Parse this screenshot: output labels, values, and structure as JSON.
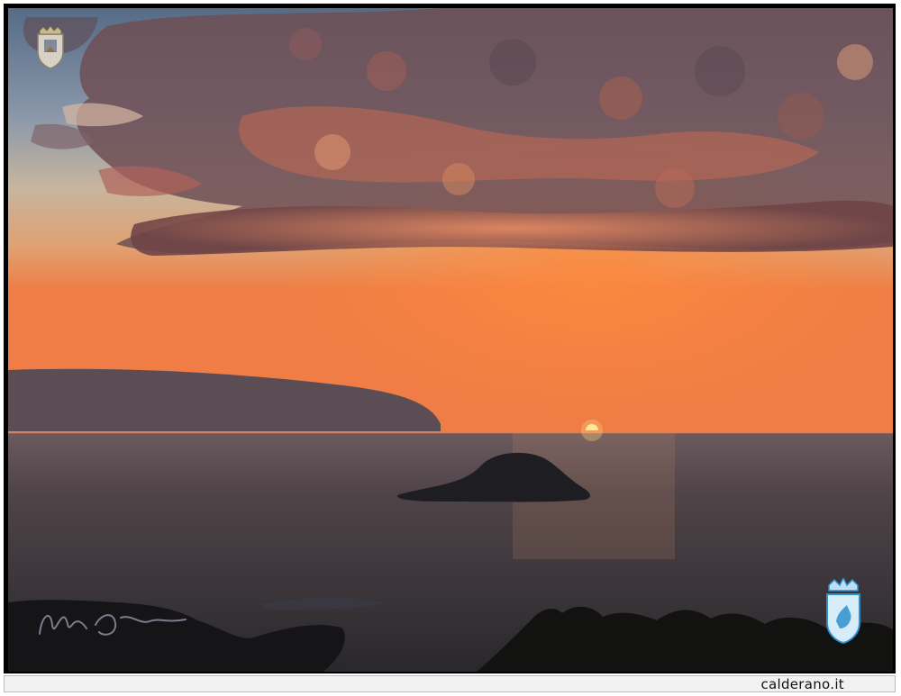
{
  "caption": {
    "site": "calderano.it"
  },
  "scene": {
    "sky_top": "#5b6f8a",
    "sky_mid": "#c9a98a",
    "horizon_glow": "#f07a3a",
    "sea": "#3a3438",
    "sun": "#fff3b0",
    "cloud": "#7a4a48",
    "cloud_lit": "#e0845e"
  },
  "icons": {
    "top_left": "coat-of-arms-icon",
    "bottom_right": "shield-crest-icon",
    "signature": "handwritten-signature"
  }
}
